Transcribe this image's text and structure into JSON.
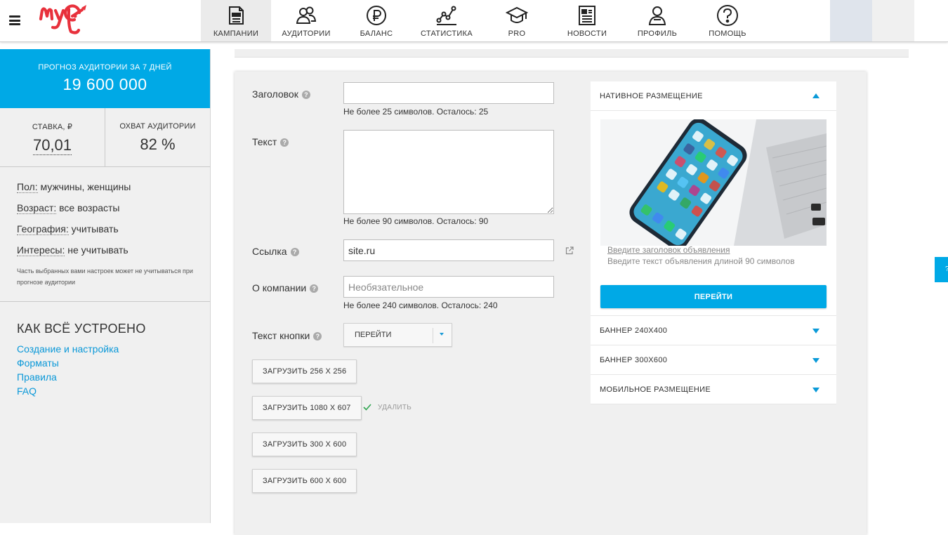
{
  "header": {
    "nav": [
      {
        "label": "КАМПАНИИ",
        "icon": "campaigns-icon",
        "active": true
      },
      {
        "label": "АУДИТОРИИ",
        "icon": "audiences-icon",
        "active": false
      },
      {
        "label": "БАЛАНС",
        "icon": "ruble-icon",
        "active": false
      },
      {
        "label": "СТАТИСТИКА",
        "icon": "chart-line-icon",
        "active": false
      },
      {
        "label": "PRO",
        "icon": "graduation-cap-icon",
        "active": false
      },
      {
        "label": "НОВОСТИ",
        "icon": "newspaper-icon",
        "active": false
      },
      {
        "label": "ПРОФИЛЬ",
        "icon": "user-icon",
        "active": false
      },
      {
        "label": "ПОМОЩЬ",
        "icon": "question-icon",
        "active": false
      }
    ]
  },
  "sidebar": {
    "forecast_label": "ПРОГНОЗ АУДИТОРИИ ЗА 7 ДНЕЙ",
    "forecast_value": "19 600 000",
    "rate_label": "СТАВКА, ₽",
    "rate_value": "70,01",
    "reach_label": "ОХВАТ АУДИТОРИИ",
    "reach_value": "82 %",
    "targeting": [
      {
        "key": "Пол:",
        "value": "мужчины, женщины"
      },
      {
        "key": "Возраст:",
        "value": "все возрасты"
      },
      {
        "key": "География:",
        "value": "учитывать"
      },
      {
        "key": "Интересы:",
        "value": "не учитывать"
      }
    ],
    "note": "Часть выбранных вами настроек может не учитываться при прогнозе аудитории",
    "howto_title": "КАК ВСЁ УСТРОЕНО",
    "howto_links": [
      "Создание и настройка",
      "Форматы",
      "Правила",
      "FAQ"
    ]
  },
  "form": {
    "title_label": "Заголовок",
    "title_value": "",
    "title_hint": "Не более  25  символов. Осталось: 25",
    "text_label": "Текст",
    "text_value": "",
    "text_hint": "Не более  90  символов. Осталось: 90",
    "link_label": "Ссылка",
    "link_value": "site.ru",
    "about_label": "О компании",
    "about_placeholder": "Необязательное",
    "about_hint": "Не более  240  символов. Осталось: 240",
    "button_text_label": "Текст кнопки",
    "button_text_value": "ПЕРЕЙТИ",
    "uploads": [
      "ЗАГРУЗИТЬ 256 X 256",
      "ЗАГРУЗИТЬ 1080 X 607",
      "ЗАГРУЗИТЬ 300 X 600",
      "ЗАГРУЗИТЬ 600 X 600"
    ],
    "delete_label": "УДАЛИТЬ"
  },
  "preview": {
    "native_label": "НАТИВНОЕ РАЗМЕЩЕНИЕ",
    "ad_title_placeholder": "Введите заголовок объявления",
    "ad_text_placeholder": "Введите текст объявления длиной 90 символов",
    "cta_label": "ПЕРЕЙТИ",
    "banner_240_label": "БАННЕР 240X400",
    "banner_300_label": "БАННЕР 300X600",
    "mobile_label": "МОБИЛЬНОЕ РАЗМЕЩЕНИЕ"
  },
  "side_tab": "?"
}
